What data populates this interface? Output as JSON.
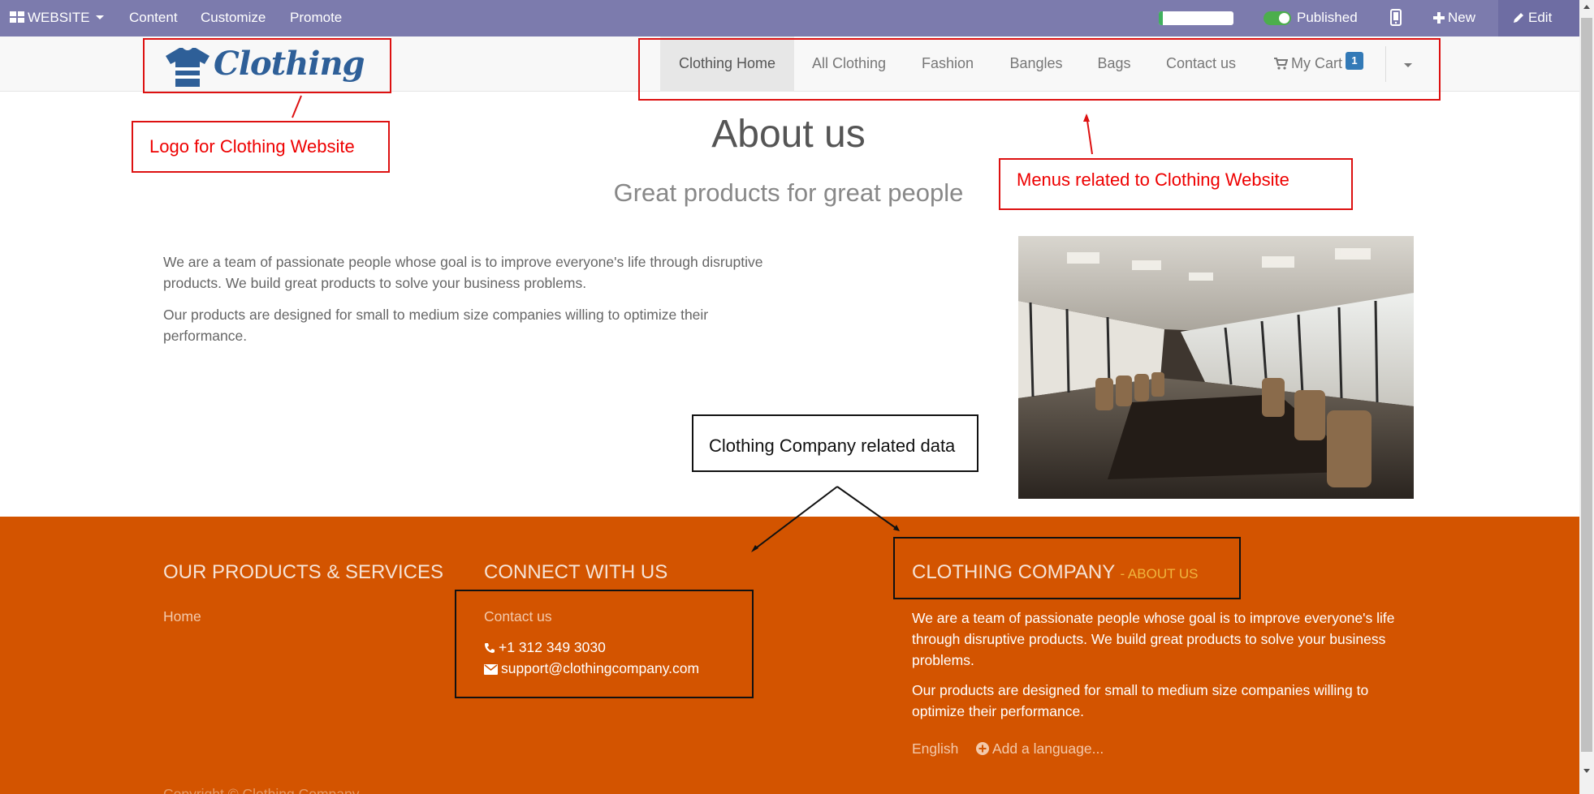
{
  "adminbar": {
    "website_label": "WEBSITE",
    "menu": [
      "Content",
      "Customize",
      "Promote"
    ],
    "progress_percent": 5,
    "published_label": "Published",
    "new_label": "New",
    "edit_label": "Edit"
  },
  "navbar": {
    "logo_text": "Clothing",
    "items": [
      "Clothing Home",
      "All Clothing",
      "Fashion",
      "Bangles",
      "Bags",
      "Contact us"
    ],
    "active_item": "Clothing Home",
    "cart_label": "My Cart",
    "cart_count": "1"
  },
  "content": {
    "title": "About us",
    "subtitle": "Great products for great people",
    "para1": "We are a team of passionate people whose goal is to improve everyone's life through disruptive products. We build great products to solve your business problems.",
    "para2": "Our products are designed for small to medium size companies willing to optimize their performance."
  },
  "footer": {
    "col1_heading": "OUR PRODUCTS & SERVICES",
    "col1_link": "Home",
    "col2_heading": "CONNECT WITH US",
    "col2_link": "Contact us",
    "phone": "+1 312 349 3030",
    "email": "support@clothingcompany.com",
    "col3_heading": "CLOTHING COMPANY",
    "col3_sub": "- ABOUT US",
    "col3_para1": "We are a team of passionate people whose goal is to improve everyone's life through disruptive products. We build great products to solve your business problems.",
    "col3_para2": "Our products are designed for small to medium size companies willing to optimize their performance.",
    "lang_current": "English",
    "lang_add": "Add a language...",
    "copyright": "Copyright © Clothing Company"
  },
  "annotations": {
    "logo_note": "Logo for Clothing Website",
    "menu_note": "Menus related to Clothing Website",
    "company_note": "Clothing Company related data"
  },
  "colors": {
    "admin_bar": "#7c7bad",
    "footer": "#d35400",
    "annotation_red": "#dd1111",
    "logo_blue": "#2e5f98"
  }
}
